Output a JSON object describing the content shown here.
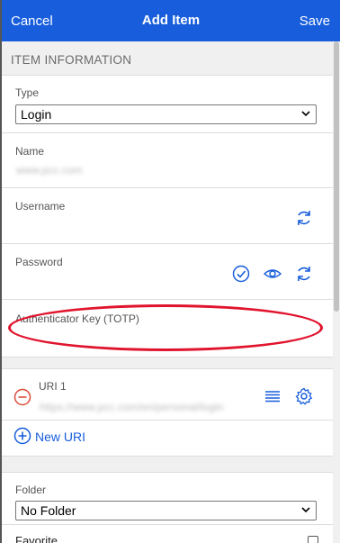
{
  "header": {
    "cancel_label": "Cancel",
    "title": "Add Item",
    "save_label": "Save"
  },
  "section": {
    "item_information": "ITEM INFORMATION"
  },
  "fields": {
    "type_label": "Type",
    "type_value": "Login",
    "name_label": "Name",
    "name_value": "www.pcc.com",
    "username_label": "Username",
    "password_label": "Password",
    "totp_label": "Authenticator Key (TOTP)",
    "uri_label": "URI 1",
    "uri_value": "https://www.pcc.com/en/personal/login",
    "new_uri_label": "New URI",
    "folder_label": "Folder",
    "folder_value": "No Folder",
    "next_label": "Favorite"
  },
  "colors": {
    "brand": "#175ddc",
    "danger": "#e0142d",
    "remove_icon": "#dd4b39"
  },
  "icons": {
    "generate_username": "refresh-icon",
    "check_password": "check-circle-icon",
    "toggle_password": "eye-icon",
    "generate_password": "refresh-icon",
    "remove_uri": "minus-circle-icon",
    "uri_match": "list-icon",
    "uri_settings": "gear-icon",
    "add_uri": "plus-circle-icon"
  }
}
